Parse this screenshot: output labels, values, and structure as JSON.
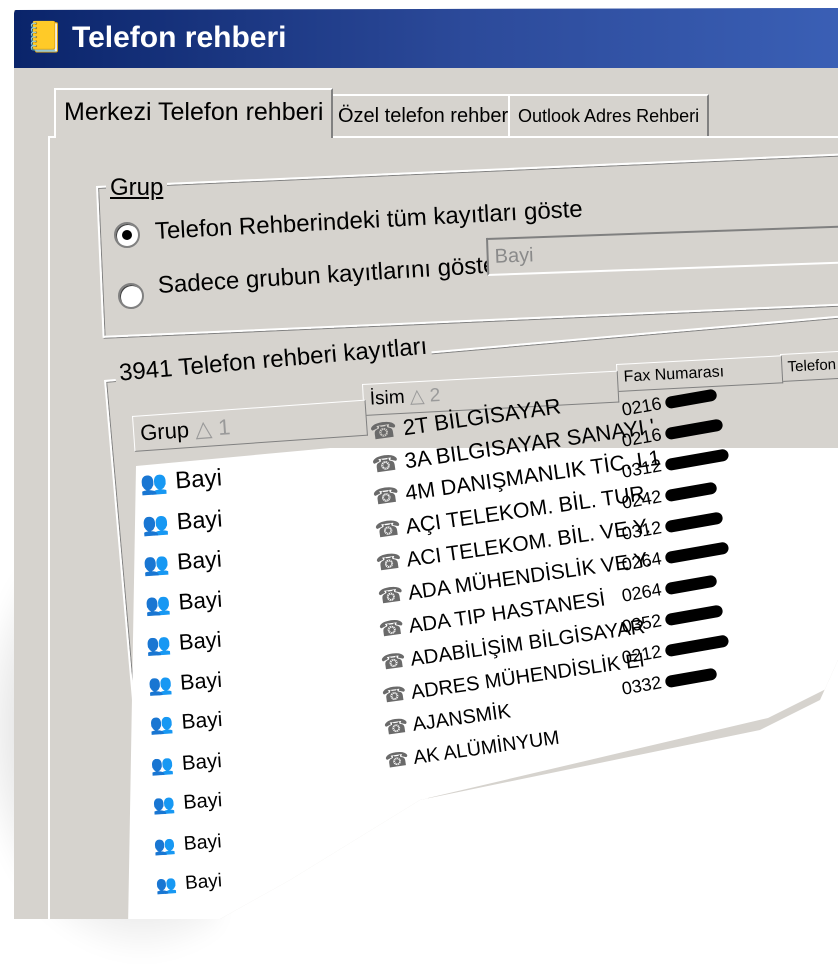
{
  "window": {
    "title": "Telefon rehberi",
    "icon": "phonebook-icon"
  },
  "tabs": [
    {
      "label": "Merkezi Telefon rehberi",
      "active": true
    },
    {
      "label": "Özel telefon rehberi",
      "active": false
    },
    {
      "label": "Outlook Adres Rehberi",
      "active": false
    }
  ],
  "grup": {
    "label": "Grup",
    "options": [
      {
        "label": "Telefon Rehberindeki tüm kayıtları göste",
        "checked": true
      },
      {
        "label": "Sadece grubun kayıtlarını göster",
        "checked": false
      }
    ],
    "group_select_value": "Bayi"
  },
  "records": {
    "label": "3941 Telefon rehberi kayıtları",
    "columns": {
      "grup": "Grup",
      "grup_sort": "△ 1",
      "isim": "İsim",
      "isim_sort": "△ 2",
      "fax": "Fax Numarası",
      "telefon": "Telefon"
    },
    "rows": [
      {
        "grup": "Bayi",
        "isim": "2T BİLGİSAYAR",
        "fax": "0216"
      },
      {
        "grup": "Bayi",
        "isim": "3A BILGISAYAR SANAYI '",
        "fax": "0216"
      },
      {
        "grup": "Bayi",
        "isim": "4M DANIŞMANLIK TİC. L1",
        "fax": "0312"
      },
      {
        "grup": "Bayi",
        "isim": "AÇI TELEKOM. BİL. TUR.",
        "fax": "0242"
      },
      {
        "grup": "Bayi",
        "isim": "ACI TELEKOM. BİL. VE Y.",
        "fax": "0312"
      },
      {
        "grup": "Bayi",
        "isim": "ADA MÜHENDİSLİK VE Y.",
        "fax": "0264"
      },
      {
        "grup": "Bayi",
        "isim": "ADA TIP HASTANESİ",
        "fax": "0264"
      },
      {
        "grup": "Bayi",
        "isim": "ADABİLİŞİM BİLGİSAYAR",
        "fax": "0352"
      },
      {
        "grup": "Bayi",
        "isim": "ADRES MÜHENDİSLİK EI",
        "fax": "0212"
      },
      {
        "grup": "Bayi",
        "isim": "AJANSMİK",
        "fax": "0332"
      },
      {
        "grup": "Bayi",
        "isim": "AK ALÜMİNYUM",
        "fax": ""
      }
    ]
  },
  "colors": {
    "titlebar": "#0a246a",
    "face": "#d6d3ce"
  }
}
